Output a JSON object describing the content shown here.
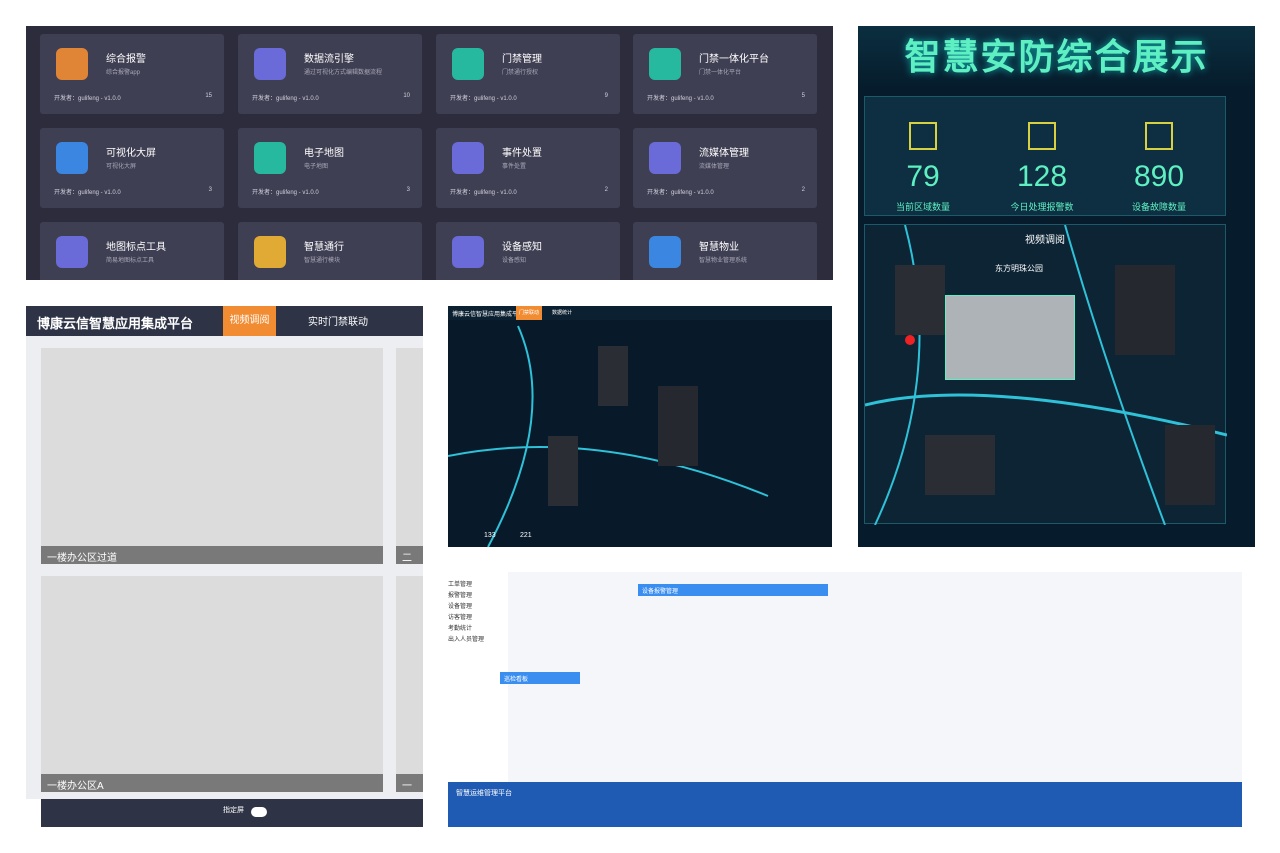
{
  "apps": [
    {
      "title": "综合报警",
      "desc": "综合报警app",
      "dev": "开发者：gulifeng - v1.0.0",
      "count": "15",
      "icon": "alarm-icon",
      "color": "#f28c32"
    },
    {
      "title": "数据流引擎",
      "desc": "通过可视化方式编辑数据流程",
      "dev": "开发者：gulifeng - v1.0.0",
      "count": "10",
      "icon": "cube-icon",
      "color": "#6f6fe8"
    },
    {
      "title": "门禁管理",
      "desc": "门禁通行授权",
      "dev": "开发者：gulifeng - v1.0.0",
      "count": "9",
      "icon": "fingerprint-icon",
      "color": "#25c6a8"
    },
    {
      "title": "门禁一体化平台",
      "desc": "门禁一体化平台",
      "dev": "开发者：gulifeng - v1.0.0",
      "count": "5",
      "icon": "fingerprint-icon",
      "color": "#25c6a8"
    },
    {
      "title": "可视化大屏",
      "desc": "可视化大屏",
      "dev": "开发者：gulifeng - v1.0.0",
      "count": "3",
      "icon": "screen-icon",
      "color": "#3a8ef0"
    },
    {
      "title": "电子地图",
      "desc": "电子地图",
      "dev": "开发者：gulifeng - v1.0.0",
      "count": "3",
      "icon": "map-icon",
      "color": "#25c6a8"
    },
    {
      "title": "事件处置",
      "desc": "事件处置",
      "dev": "开发者：gulifeng - v1.0.0",
      "count": "2",
      "icon": "cube-icon",
      "color": "#6f6fe8"
    },
    {
      "title": "流媒体管理",
      "desc": "流媒体管理",
      "dev": "开发者：gulifeng - v1.0.0",
      "count": "2",
      "icon": "cube-icon",
      "color": "#6f6fe8"
    },
    {
      "title": "地图标点工具",
      "desc": "简易地图标点工具",
      "dev": "",
      "count": "",
      "icon": "cube-icon",
      "color": "#6f6fe8"
    },
    {
      "title": "智慧通行",
      "desc": "智慧通行模块",
      "dev": "",
      "count": "",
      "icon": "bus-icon",
      "color": "#f2b632"
    },
    {
      "title": "设备感知",
      "desc": "设备感知",
      "dev": "",
      "count": "",
      "icon": "cube-icon",
      "color": "#6f6fe8"
    },
    {
      "title": "智慧物业",
      "desc": "智慧物业管理系统",
      "dev": "",
      "count": "",
      "icon": "house-icon",
      "color": "#3a8ef0"
    }
  ],
  "dashboard": {
    "title": "智慧安防综合展示",
    "stats": [
      {
        "value": "79",
        "label": "当前区域数量"
      },
      {
        "value": "128",
        "label": "今日处理报警数"
      },
      {
        "value": "890",
        "label": "设备故障数量"
      }
    ],
    "video_title": "视频调阅",
    "location": "东方明珠公园"
  },
  "video": {
    "title": "博康云信智慧应用集成平台",
    "tab_active": "视频调阅",
    "tab_other": "实时门禁联动",
    "cams": [
      "一楼办公区过道",
      "二楼",
      "一楼办公区A",
      "一楼"
    ],
    "toggle_label": "指定屏"
  },
  "map": {
    "title": "博康云信智慧应用集成平台",
    "tab_active": "门禁联动",
    "tab_other": "数据统计",
    "stats": [
      {
        "value": "133"
      },
      {
        "value": "221"
      }
    ]
  },
  "light": {
    "left_menu": [
      "工单管理",
      "报警管理",
      "设备管理",
      "访客管理",
      "考勤统计",
      "出入人员管理"
    ],
    "panel_title": "设备报警管理",
    "tab_label": "巡检看板",
    "bottom_title": "智慧运维管理平台"
  }
}
